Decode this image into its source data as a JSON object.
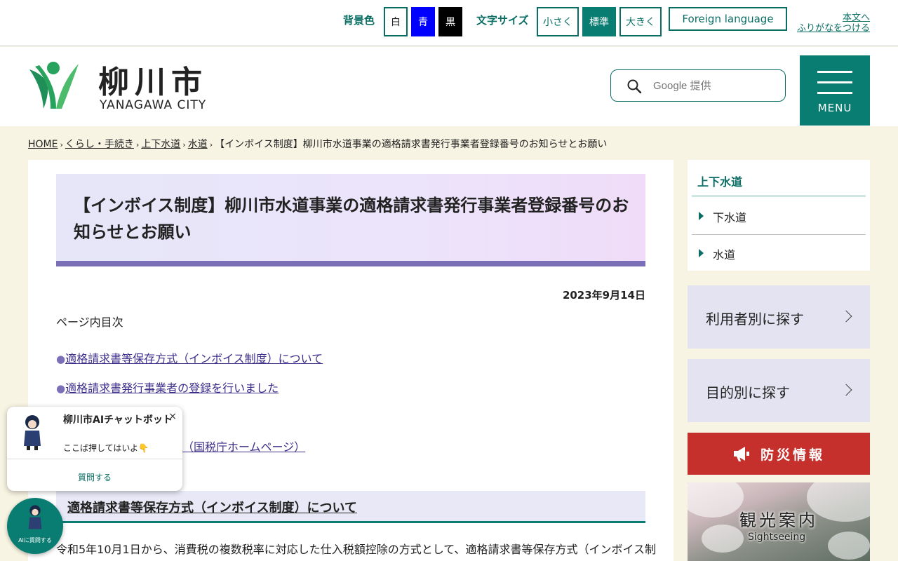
{
  "topbar": {
    "bg_label": "背景色",
    "bg_white": "白",
    "bg_blue": "青",
    "bg_black": "黒",
    "text_size_label": "文字サイズ",
    "size_small": "小さく",
    "size_standard": "標準",
    "size_large": "大きく",
    "foreign_language": "Foreign language",
    "furigana_line1": "本文へ",
    "furigana_line2": "ふりがなをつける"
  },
  "header": {
    "city_name": "柳川市",
    "city_name_en": "YANAGAWA CITY",
    "search_placeholder": "Google 提供",
    "menu_label": "MENU"
  },
  "breadcrumb": {
    "items": [
      "HOME",
      "くらし・手続き",
      "上下水道",
      "水道"
    ],
    "current": "【インボイス制度】柳川市水道事業の適格請求書発行事業者登録番号のお知らせとお願い"
  },
  "main": {
    "title": "【インボイス制度】柳川市水道事業の適格請求書発行事業者登録番号のお知らせとお願い",
    "date": "2023年9月14日",
    "toc_title": "ページ内目次",
    "toc": [
      "適格請求書等保存方式（インボイス制度）について",
      "適格請求書発行事業者の登録を行いました",
      "（国税庁ホームページ）"
    ],
    "toc_bullet": "●",
    "section_heading": "適格請求書等保存方式（インボイス制度）について",
    "body_text": "令和5年10月1日から、消費税の複数税率に対応した仕入税額控除の方式として、適格請求書等保存方式（インボイス制"
  },
  "sidebar": {
    "nav_title": "上下水道",
    "nav_items": [
      "下水道",
      "水道"
    ],
    "find_by_user": "利用者別に探す",
    "find_by_purpose": "目的別に探す",
    "disaster": "防災情報",
    "tourism": "観光案内",
    "tourism_sub": "Sightseeing"
  },
  "chatbot": {
    "title": "柳川市AIチャットボット",
    "close": "×",
    "message": "ここば押してはいよ👇",
    "ask": "質問する",
    "fab_label": "AIに質問する"
  },
  "colors": {
    "accent": "#0a7d72",
    "title_bar": "#7b6fb8",
    "disaster": "#c5302d"
  }
}
